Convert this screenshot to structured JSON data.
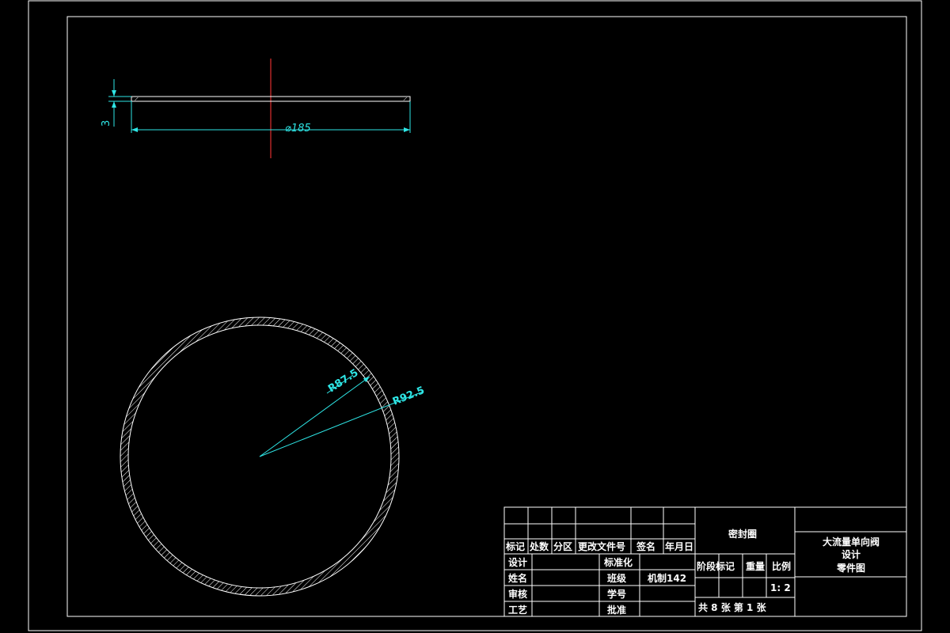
{
  "drawing": {
    "dimensions": {
      "thickness": "3",
      "diameter": "⌀185",
      "inner_radius": "R87.5",
      "outer_radius": "R92.5"
    }
  },
  "title_block": {
    "part_name": "密封圈",
    "project_line1": "大流量单向阀",
    "project_line2": "设计",
    "project_line3": "零件图",
    "headers": {
      "mark": "标记",
      "count": "处数",
      "zone": "分区",
      "change_doc": "更改文件号",
      "signature": "签名",
      "date": "年月日"
    },
    "rows": {
      "design": "设计",
      "name": "姓名",
      "review": "审核",
      "process": "工艺",
      "standardization": "标准化",
      "class": "班级",
      "class_value": "机制142",
      "student_no": "学号",
      "approve": "批准"
    },
    "stage_mark": "阶段标记",
    "weight": "重量",
    "scale_label": "比例",
    "scale_value": "1: 2",
    "sheets": "共 8 张 第 1 张"
  }
}
